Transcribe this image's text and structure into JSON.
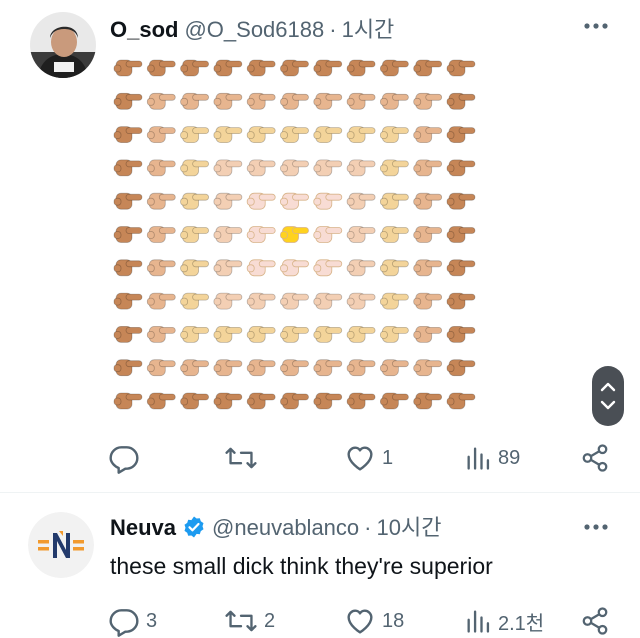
{
  "colors": {
    "skin_tones": [
      "#ffd21f",
      "#f8dcd4",
      "#f3cfb4",
      "#f3d49a",
      "#e7b58f",
      "#c68657",
      "#8d5534",
      "#5c3a22"
    ],
    "text_primary": "#0f1419",
    "text_secondary": "#536471",
    "verified_blue": "#1d9bf0",
    "neuva_orange": "#f29a2e",
    "neuva_navy": "#233a6b"
  },
  "emoji_grid": {
    "icon": "backhand-index-pointing-right-icon",
    "rows": 11,
    "cols": 11,
    "center_tone": "#ffd21f"
  },
  "tweets": [
    {
      "display_name": "O_sod",
      "handle": "@O_Sod6188",
      "separator": "·",
      "time": "1시간",
      "avatar_icon": "profile-photo-icon",
      "stats": {
        "replies": "",
        "reposts": "",
        "likes": "1",
        "views": "89"
      }
    },
    {
      "display_name": "Neuva",
      "handle": "@neuvablanco",
      "separator": "·",
      "time": "10시간",
      "avatar_icon": "neuva-logo-icon",
      "text": "these small dick think they're superior",
      "stats": {
        "replies": "3",
        "reposts": "2",
        "likes": "18",
        "views": "2.1천"
      }
    }
  ]
}
